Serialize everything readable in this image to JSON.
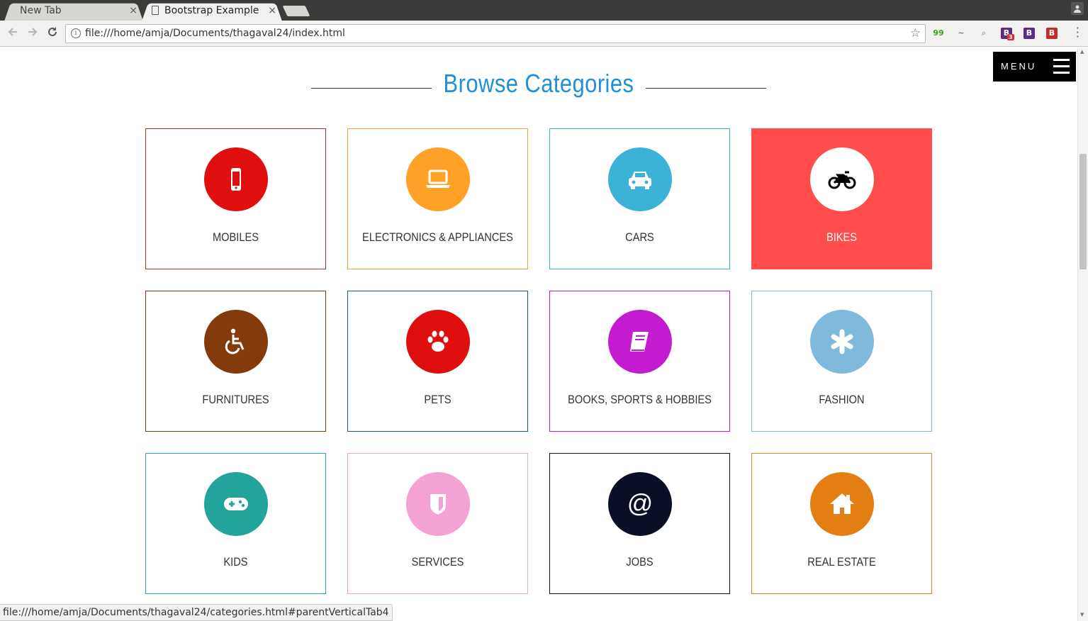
{
  "browser": {
    "tabs": [
      {
        "label": "New Tab"
      },
      {
        "label": "Bootstrap Example"
      }
    ],
    "close_glyph": "×",
    "address": "file:///home/amja/Documents/thagaval24/index.html",
    "extensions": [
      {
        "icon": "ext-tracker-icon",
        "glyph": "99",
        "color": "#3aa317"
      },
      {
        "icon": "ext-leaf-icon",
        "glyph": "~",
        "color": "#777777"
      },
      {
        "icon": "ext-search-icon",
        "glyph": "⌕",
        "color": "#aaaaaa"
      },
      {
        "icon": "ext-bootstrap-icon",
        "glyph": "B",
        "color": "#5a2d83",
        "badge": "3"
      },
      {
        "icon": "ext-bootstrap-icon",
        "glyph": "B",
        "color": "#5a2d83"
      },
      {
        "icon": "ext-bootstrap-red-icon",
        "glyph": "B",
        "color": "#c12d2d"
      }
    ],
    "status_url": "file:///home/amja/Documents/thagaval24/categories.html#parentVerticalTab4"
  },
  "page": {
    "menu_label": "MENU",
    "heading": "Browse Categories",
    "accent_color": "#1f8fd6",
    "categories": [
      {
        "label": "MOBILES",
        "icon": "mobile-phone-icon",
        "border": "#c0282e",
        "circle": "#e00f0f",
        "bg": "#ffffff",
        "glyph_color": "#ffffff"
      },
      {
        "label": "ELECTRONICS & APPLIANCES",
        "icon": "laptop-icon",
        "border": "#f0a23a",
        "circle": "#ffa126",
        "bg": "#ffffff",
        "glyph_color": "#ffffff"
      },
      {
        "label": "CARS",
        "icon": "car-icon",
        "border": "#3aaed8",
        "circle": "#3cb3d6",
        "bg": "#ffffff",
        "glyph_color": "#ffffff"
      },
      {
        "label": "BIKES",
        "icon": "motorcycle-icon",
        "border": "#ff4d4d",
        "circle": "#ffffff",
        "bg": "#ff4d4d",
        "glyph_color": "#000000",
        "label_color": "#ffffff",
        "active": true
      },
      {
        "label": "FURNITURES",
        "icon": "wheelchair-icon",
        "border": "#7b3a10",
        "circle": "#833b0b",
        "bg": "#ffffff",
        "glyph_color": "#ffffff"
      },
      {
        "label": "PETS",
        "icon": "paw-icon",
        "border": "#1c4fa8",
        "circle": "#e00f0f",
        "bg": "#ffffff",
        "glyph_color": "#ffffff"
      },
      {
        "label": "BOOKS, SPORTS & HOBBIES",
        "icon": "book-icon",
        "border": "#c01bc8",
        "circle": "#c41bd1",
        "bg": "#ffffff",
        "glyph_color": "#ffffff"
      },
      {
        "label": "FASHION",
        "icon": "asterisk-icon",
        "border": "#7fb9dc",
        "circle": "#7fb9dc",
        "bg": "#ffffff",
        "glyph_color": "#ffffff"
      },
      {
        "label": "KIDS",
        "icon": "gamepad-icon",
        "border": "#2aa0c4",
        "circle": "#23a49a",
        "bg": "#ffffff",
        "glyph_color": "#ffffff"
      },
      {
        "label": "SERVICES",
        "icon": "shield-icon",
        "border": "#f1a1d3",
        "circle": "#f4a1d4",
        "bg": "#ffffff",
        "glyph_color": "#ffffff"
      },
      {
        "label": "JOBS",
        "icon": "at-sign-icon",
        "border": "#111111",
        "circle": "#0b0f26",
        "bg": "#ffffff",
        "glyph_color": "#ffffff"
      },
      {
        "label": "REAL ESTATE",
        "icon": "home-icon",
        "border": "#e0861a",
        "circle": "#e37f12",
        "bg": "#ffffff",
        "glyph_color": "#ffffff"
      }
    ]
  }
}
